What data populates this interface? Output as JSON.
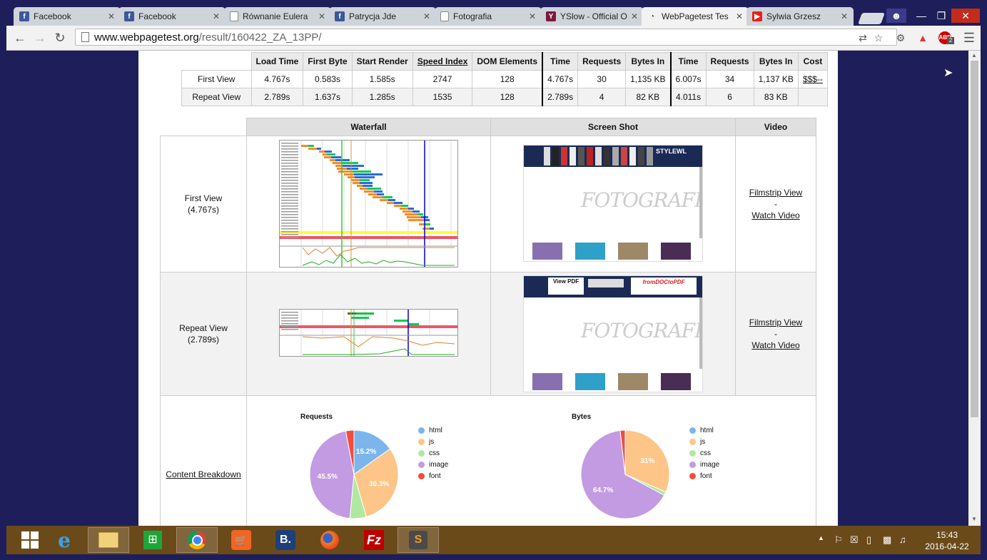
{
  "browser": {
    "tabs": [
      {
        "label": "Facebook",
        "icon": "facebook-icon",
        "active": false
      },
      {
        "label": "Facebook",
        "icon": "facebook-icon",
        "active": false
      },
      {
        "label": "Równanie Eulera",
        "icon": "document-icon",
        "active": false
      },
      {
        "label": "Patrycja Jde",
        "icon": "facebook-icon",
        "active": false
      },
      {
        "label": "Fotografia",
        "icon": "document-icon",
        "active": false
      },
      {
        "label": "YSlow - Official O",
        "icon": "yslow-icon",
        "active": false
      },
      {
        "label": "WebPagetest Tes",
        "icon": "webpagetest-icon",
        "active": true
      },
      {
        "label": "Sylwia Grzesz",
        "icon": "youtube-icon",
        "active": false
      }
    ],
    "url_domain": "www.webpagetest.org",
    "url_path": "/result/160422_ZA_13PP/",
    "abp_badge": "2"
  },
  "summary": {
    "headers": [
      "Load Time",
      "First Byte",
      "Start Render",
      "Speed Index",
      "DOM Elements",
      "Time",
      "Requests",
      "Bytes In",
      "Time",
      "Requests",
      "Bytes In",
      "Cost"
    ],
    "rows": [
      {
        "label": "First View",
        "values": [
          "4.767s",
          "0.583s",
          "1.585s",
          "2747",
          "128",
          "4.767s",
          "30",
          "1,135 KB",
          "6.007s",
          "34",
          "1,137 KB",
          "$$$--"
        ]
      },
      {
        "label": "Repeat View",
        "values": [
          "2.789s",
          "1.637s",
          "1.285s",
          "1535",
          "128",
          "2.789s",
          "4",
          "82 KB",
          "4.011s",
          "6",
          "83 KB",
          ""
        ]
      }
    ]
  },
  "results": {
    "col_waterfall": "Waterfall",
    "col_screenshot": "Screen Shot",
    "col_video": "Video",
    "first_label": "First View",
    "first_time": "(4.767s)",
    "repeat_label": "Repeat View",
    "repeat_time": "(2.789s)",
    "filmstrip": "Filmstrip View",
    "sep": "-",
    "watch": "Watch Video",
    "content_breakdown": "Content Breakdown",
    "shot_logo": "FOTOGRAFIA.pl",
    "shot_ad_brand": "STYLEWL",
    "shot2_ad": "View PDF",
    "shot2_ad_brand": "fromDOCtoPDF"
  },
  "chart_data": [
    {
      "type": "pie",
      "title": "Requests",
      "categories": [
        "html",
        "js",
        "css",
        "image",
        "font"
      ],
      "values": [
        15.2,
        30.3,
        6.0,
        45.5,
        3.0
      ],
      "labels": [
        "15.2%",
        "30.3%",
        "",
        "45.5%",
        ""
      ],
      "colors": [
        "#7cb5ec",
        "#fdc588",
        "#b0e8a0",
        "#c39be2",
        "#f24c3c"
      ]
    },
    {
      "type": "pie",
      "title": "Bytes",
      "categories": [
        "html",
        "js",
        "css",
        "image",
        "font"
      ],
      "values": [
        0.2,
        31.0,
        1.3,
        64.7,
        1.8
      ],
      "labels": [
        "",
        "31%",
        "",
        "64.7%",
        ""
      ],
      "colors": [
        "#7cb5ec",
        "#fdc588",
        "#b0e8a0",
        "#c39be2",
        "#f24c3c"
      ]
    }
  ],
  "taskbar": {
    "time": "15:43",
    "date": "2016-04-22"
  }
}
